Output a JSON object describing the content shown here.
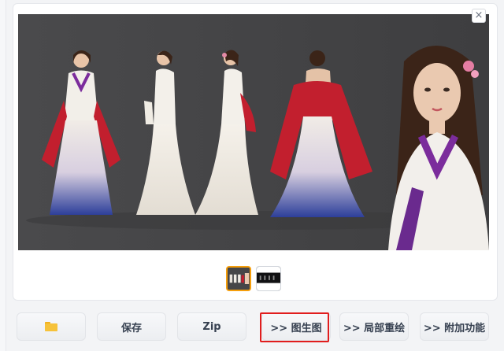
{
  "gallery": {
    "close_symbol": "×",
    "thumbnails": [
      {
        "name": "character-turnaround-thumbnail",
        "selected": true
      },
      {
        "name": "dark-thumbnail",
        "selected": false
      }
    ]
  },
  "toolbar": {
    "folder_icon": "folder-icon",
    "save_label": "保存",
    "zip_label": "Zip",
    "img2img_label": ">> 图生图",
    "inpaint_label": ">> 局部重绘",
    "extras_label": ">> 附加功能"
  },
  "colors": {
    "highlight": "#e11d1d",
    "selected_thumb": "#f59e0b",
    "folder": "#f6c23a"
  }
}
